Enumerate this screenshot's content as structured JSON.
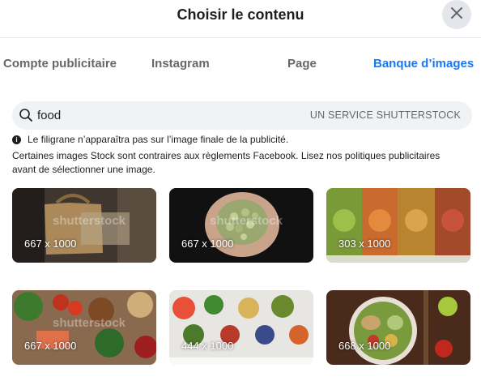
{
  "dialog": {
    "title": "Choisir le contenu",
    "close_icon": "close-icon"
  },
  "tabs": [
    {
      "label": "Compte publicitaire",
      "active": false
    },
    {
      "label": "Instagram",
      "active": false
    },
    {
      "label": "Page",
      "active": false
    },
    {
      "label": "Banque d’images",
      "active": true
    }
  ],
  "search": {
    "value": "food",
    "provider": "UN SERVICE SHUTTERSTOCK",
    "icon": "search-icon"
  },
  "notice": {
    "watermark_text": "Le filigrane n’apparaîtra pas sur l’image finale de la publicité.",
    "policy_line1": "Certaines images Stock sont contraires aux règlements Facebook. Lisez nos politiques publicitaires",
    "policy_line2": "avant de sélectionner une image."
  },
  "images": [
    {
      "dims": "667 x 1000"
    },
    {
      "dims": "667 x 1000"
    },
    {
      "dims": "303 x 1000"
    },
    {
      "dims": "667 x 1000"
    },
    {
      "dims": "444 x 1000"
    },
    {
      "dims": "668 x 1000"
    }
  ],
  "colors": {
    "accent": "#1877f2",
    "muted": "#65676b",
    "search_bg": "#f0f2f5"
  }
}
